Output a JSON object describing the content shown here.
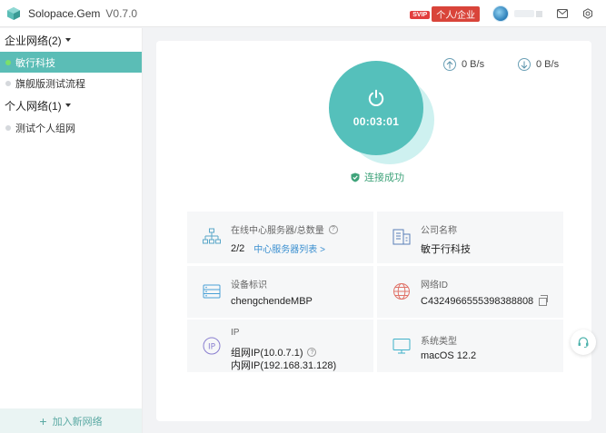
{
  "app": {
    "title": "Solopace.Gem",
    "version": "V0.7.0"
  },
  "header": {
    "vip_tag": "SVIP",
    "account_type": "个人/企业",
    "colors": {
      "accent": "#55c0bb",
      "vip": "#d9443a"
    }
  },
  "sidebar": {
    "groups": [
      {
        "label": "企业网络(2)",
        "items": [
          {
            "label": "敏行科技",
            "active": true
          },
          {
            "label": "旗舰版测试流程",
            "active": false
          }
        ]
      },
      {
        "label": "个人网络(1)",
        "items": [
          {
            "label": "测试个人组网",
            "active": false
          }
        ]
      }
    ],
    "add_network": "加入新网络"
  },
  "speed": {
    "upload": "0 B/s",
    "download": "0 B/s"
  },
  "connection": {
    "timer": "00:03:01",
    "status": "连接成功"
  },
  "info": {
    "servers": {
      "label": "在线中心服务器/总数量",
      "value": "2/2",
      "link": "中心服务器列表 >"
    },
    "company": {
      "label": "公司名称",
      "value": "敏于行科技"
    },
    "device": {
      "label": "设备标识",
      "value": "chengchendeMBP"
    },
    "network_id": {
      "label": "网络ID",
      "value": "C4324966555398388808"
    },
    "ip": {
      "label": "IP",
      "group_ip": "组网IP(10.0.7.1)",
      "lan_ip": "内网IP(192.168.31.128)"
    },
    "os": {
      "label": "系统类型",
      "value": "macOS 12.2"
    }
  },
  "icons": [
    "app-logo-icon",
    "avatar",
    "mail-icon",
    "gear-icon",
    "upload-icon",
    "download-icon",
    "power-icon",
    "shield-check-icon",
    "server-tree-icon",
    "building-icon",
    "device-icon",
    "globe-icon",
    "ip-icon",
    "monitor-icon",
    "headset-icon",
    "plus-icon"
  ]
}
